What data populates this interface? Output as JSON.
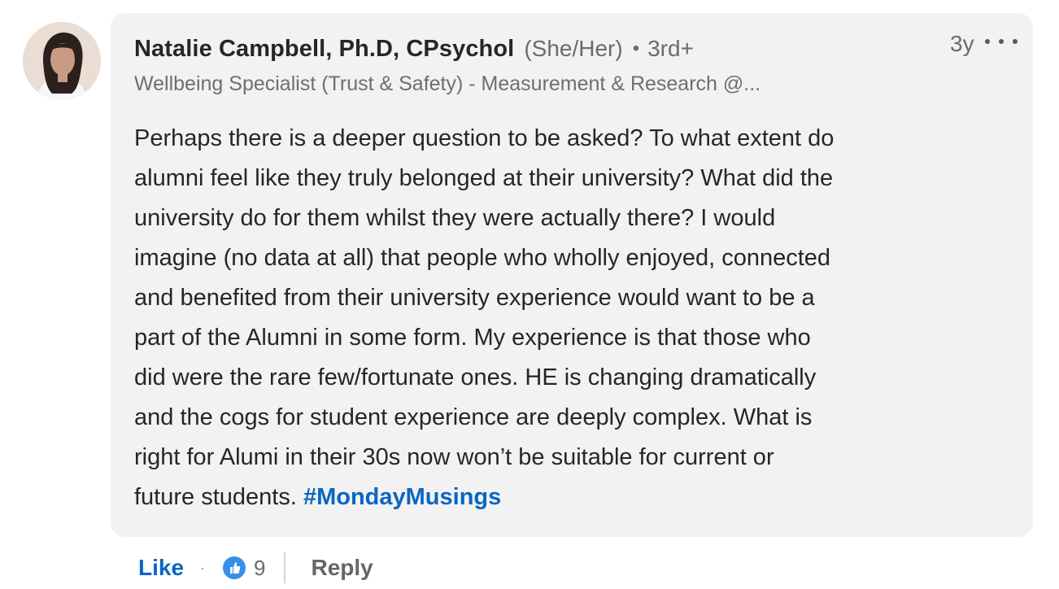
{
  "comment": {
    "author": {
      "name": "Natalie Campbell, Ph.D, CPsychol",
      "pronouns": "(She/Her)",
      "separator": "•",
      "connection_degree": "3rd+",
      "headline": "Wellbeing Specialist (Trust & Safety) - Measurement & Research @..."
    },
    "timestamp": "3y",
    "more_icon": "more-horizontal-icon",
    "body": {
      "text": "Perhaps there is a deeper question to be asked? To what extent do\nalumni feel like they truly belonged at their university? What did the\nuniversity do for them whilst they were actually there? I would\nimagine (no data at all) that people who wholly enjoyed, connected\nand benefited from their university experience would want to be a\npart of the Alumni in some form. My experience is that those who\ndid were the rare few/fortunate ones. HE is changing dramatically\nand the cogs for student experience are deeply complex. What is\nright for Alumi in their 30s now won’t be suitable for current or\nfuture students. ",
      "hashtag": "#MondayMusings"
    }
  },
  "actions": {
    "like_label": "Like",
    "separator": "·",
    "reaction_icon": "thumbs-up-icon",
    "reaction_count": "9",
    "reply_label": "Reply"
  },
  "colors": {
    "bubble_background": "#f2f2f2",
    "link_blue": "#0a66c2",
    "reaction_blue": "#378fe9",
    "muted_text": "#6b6b6b"
  }
}
